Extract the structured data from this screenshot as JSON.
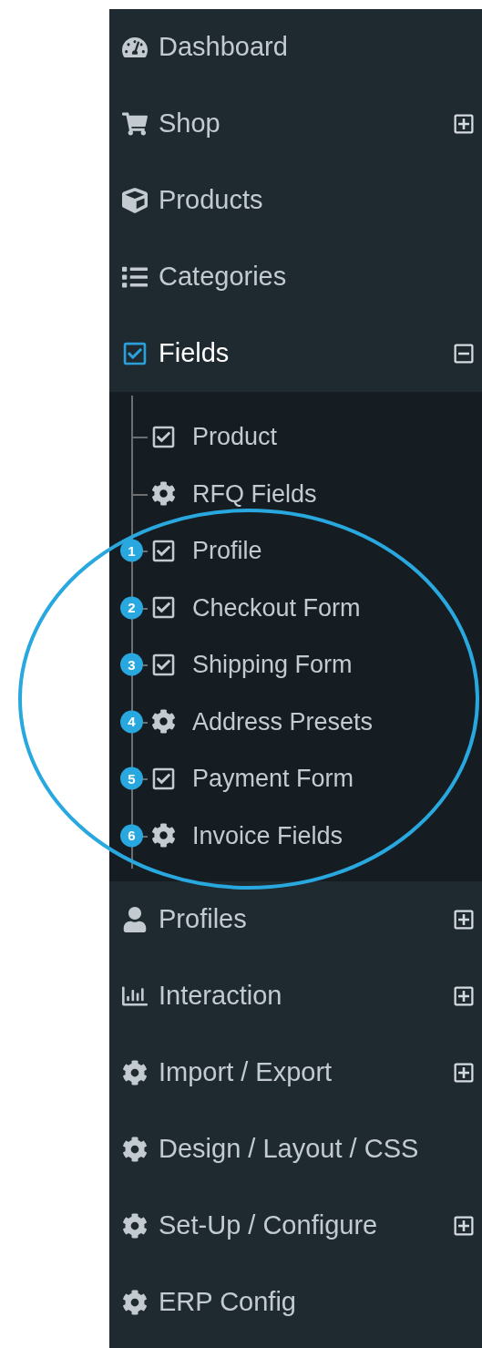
{
  "menu": [
    {
      "label": "Dashboard",
      "kind": "gauge",
      "selected": false
    },
    {
      "label": "Shop",
      "kind": "cart",
      "selected": false,
      "expanded": false
    },
    {
      "label": "Products",
      "kind": "cube",
      "selected": false
    },
    {
      "label": "Categories",
      "kind": "list",
      "selected": false
    },
    {
      "label": "Fields",
      "kind": "check",
      "selected": true,
      "expanded": true,
      "children": [
        {
          "label": "Product",
          "kind": "check"
        },
        {
          "label": "RFQ Fields",
          "kind": "gear"
        },
        {
          "label": "Profile",
          "kind": "check",
          "badge": "1"
        },
        {
          "label": "Checkout Form",
          "kind": "check",
          "badge": "2"
        },
        {
          "label": "Shipping Form",
          "kind": "check",
          "badge": "3"
        },
        {
          "label": "Address Presets",
          "kind": "gear",
          "badge": "4"
        },
        {
          "label": "Payment Form",
          "kind": "check",
          "badge": "5"
        },
        {
          "label": "Invoice Fields",
          "kind": "gear",
          "badge": "6"
        }
      ]
    },
    {
      "label": "Profiles",
      "kind": "user",
      "selected": false,
      "expanded": false
    },
    {
      "label": "Interaction",
      "kind": "chart",
      "selected": false,
      "expanded": false
    },
    {
      "label": "Import / Export",
      "kind": "gear",
      "selected": false,
      "expanded": false
    },
    {
      "label": "Design / Layout / CSS",
      "kind": "gear",
      "selected": false
    },
    {
      "label": "Set-Up / Configure",
      "kind": "gear",
      "selected": false,
      "expanded": false
    },
    {
      "label": "ERP Config",
      "kind": "gear",
      "selected": false
    }
  ]
}
